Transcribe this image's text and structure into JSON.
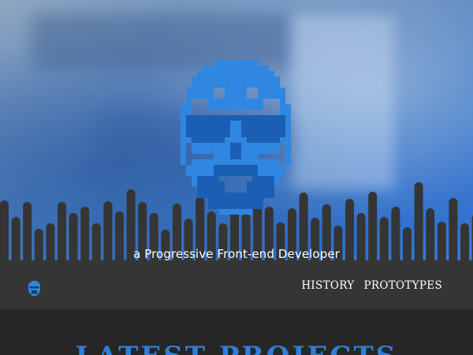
{
  "hero": {
    "tagline": "a Progressive Front-end Developer",
    "avatar_icon": "pixel-bearded-face-with-sunglasses",
    "accent_color": "#2f86e0",
    "wave_color": "#353535"
  },
  "header": {
    "logo_icon": "pixel-face-logo",
    "nav": [
      {
        "label": "HISTORY"
      },
      {
        "label": "PROTOTYPES"
      }
    ]
  },
  "main": {
    "section_title": "LATEST PROJECTS"
  }
}
